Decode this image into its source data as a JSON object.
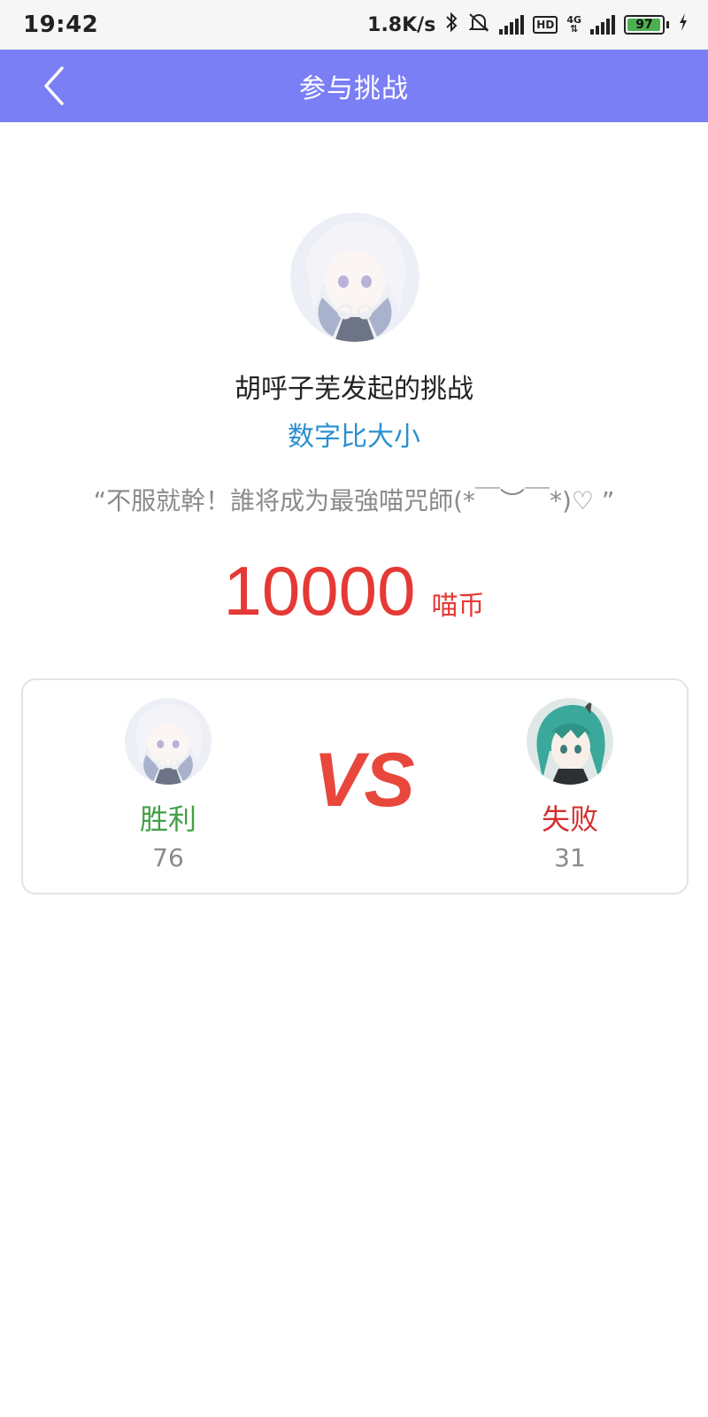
{
  "status_bar": {
    "time": "19:42",
    "speed": "1.8K/s",
    "hd": "HD",
    "network": "4G",
    "battery": "97",
    "battery_level": 0.97
  },
  "header": {
    "title": "参与挑战"
  },
  "challenge": {
    "initiator": "胡呼子芜发起的挑战",
    "game_type": "数字比大小",
    "quote": "“不服就幹！誰将成为最強喵咒師(*￣︶￣*)♡ ”",
    "amount": "10000",
    "unit": "喵币"
  },
  "versus": {
    "vs_text": "VS",
    "left": {
      "result": "胜利",
      "score": "76"
    },
    "right": {
      "result": "失败",
      "score": "31"
    }
  },
  "colors": {
    "header_bg": "#7b7ff6",
    "game_type": "#2a8fd0",
    "prize": "#e53935",
    "win": "#43a047",
    "lose": "#d32f2f"
  }
}
